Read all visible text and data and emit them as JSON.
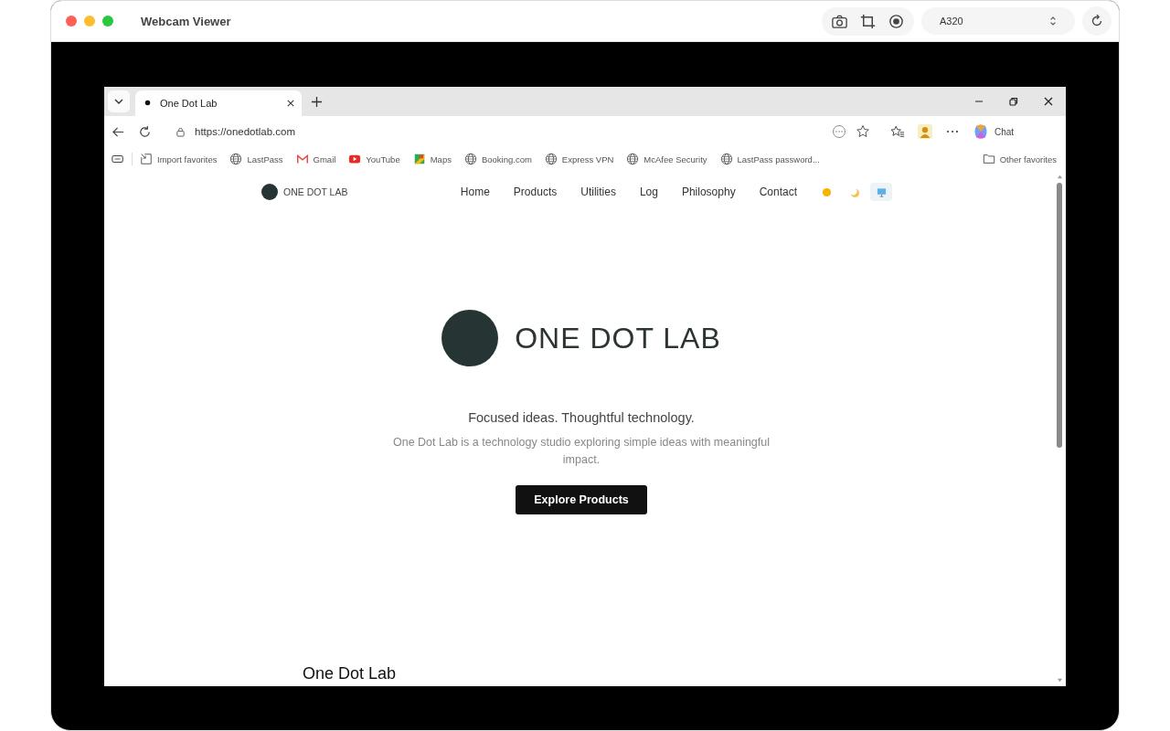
{
  "window": {
    "title": "Webcam Viewer",
    "camera": "A320"
  },
  "browser": {
    "tab": {
      "title": "One Dot Lab",
      "selected": true
    },
    "url": "https://onedotlab.com",
    "chat": "Chat",
    "bookmarks": [
      {
        "kind": "import",
        "label": "Import favorites"
      },
      {
        "kind": "globe",
        "label": "LastPass"
      },
      {
        "kind": "gmail",
        "label": "Gmail"
      },
      {
        "kind": "youtube",
        "label": "YouTube"
      },
      {
        "kind": "maps",
        "label": "Maps"
      },
      {
        "kind": "globe",
        "label": "Booking.com"
      },
      {
        "kind": "globe",
        "label": "Express VPN"
      },
      {
        "kind": "globe",
        "label": "McAfee Security"
      },
      {
        "kind": "globe",
        "label": "LastPass password..."
      }
    ],
    "other_favorites": "Other favorites"
  },
  "site": {
    "brand": "ONE DOT LAB",
    "nav": [
      "Home",
      "Products",
      "Utilities",
      "Log",
      "Philosophy",
      "Contact"
    ],
    "themes": [
      {
        "kind": "sun",
        "selected": false
      },
      {
        "kind": "moon",
        "selected": false
      },
      {
        "kind": "monitor",
        "selected": true
      }
    ],
    "hero_title": "ONE DOT LAB",
    "tagline": "Focused ideas. Thoughtful technology.",
    "description": "One Dot Lab is a technology studio exploring simple ideas with meaningful impact.",
    "cta": "Explore Products",
    "section_heading": "One Dot Lab"
  }
}
